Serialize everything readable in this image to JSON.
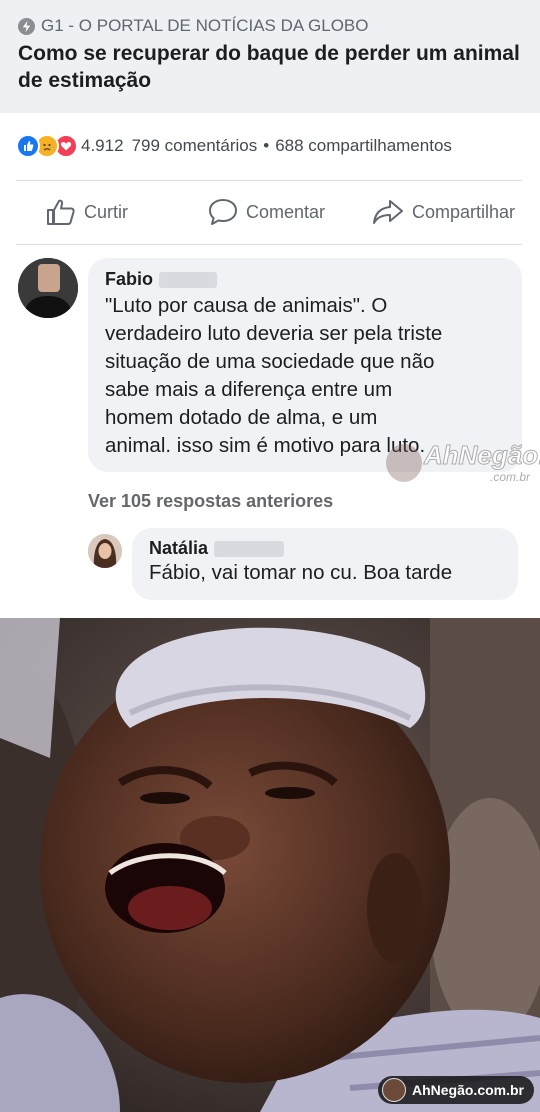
{
  "link_preview": {
    "source": "G1 - O PORTAL DE NOTÍCIAS DA GLOBO",
    "title": "Como se recuperar do baque de perder um animal de estimação"
  },
  "stats": {
    "reactions_count": "4.912",
    "comments": "799 comentários",
    "separator": "•",
    "shares": "688 compartilhamentos"
  },
  "actions": {
    "like": "Curtir",
    "comment": "Comentar",
    "share": "Compartilhar"
  },
  "comments": [
    {
      "author": "Fabio",
      "lines": [
        "\"Luto por causa de animais\".  O",
        "verdadeiro luto deveria ser pela triste",
        "situação de uma sociedade que não",
        "sabe mais a diferença entre um",
        "homem dotado de alma, e um",
        "animal. isso sim é motivo para luto."
      ]
    }
  ],
  "replies_link": "Ver 105 respostas anteriores",
  "reply": {
    "author": "Natália",
    "text": "Fábio, vai tomar no cu. Boa tarde"
  },
  "watermark": {
    "brand": "AhNegão!",
    "domain": ".com.br"
  },
  "footer_badge": "AhNegão.com.br",
  "colors": {
    "like_blue": "#1877f2",
    "sad_yellow": "#f7b125",
    "love_red": "#f33e58",
    "bubble_gray": "#f0f2f5",
    "header_gray": "#eef0f3"
  },
  "icons": [
    "globe-icon",
    "like-reaction-icon",
    "sad-reaction-icon",
    "love-reaction-icon",
    "thumbs-up-icon",
    "comment-icon",
    "share-arrow-icon"
  ]
}
